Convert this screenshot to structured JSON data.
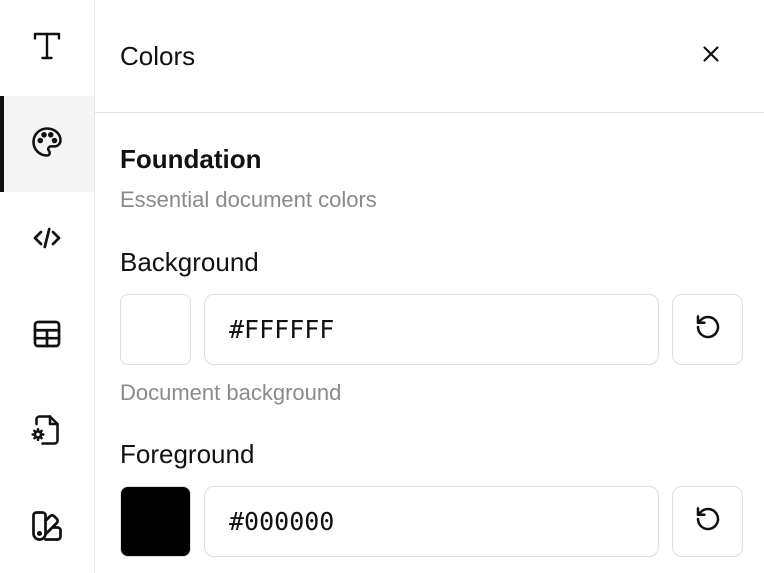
{
  "sidebar": {
    "items": [
      {
        "icon": "text-icon",
        "active": false
      },
      {
        "icon": "palette-icon",
        "active": true
      },
      {
        "icon": "code-icon",
        "active": false
      },
      {
        "icon": "table-icon",
        "active": false
      },
      {
        "icon": "file-settings-icon",
        "active": false
      },
      {
        "icon": "swatch-book-icon",
        "active": false
      }
    ]
  },
  "panel": {
    "title": "Colors",
    "section": {
      "title": "Foundation",
      "description": "Essential document colors"
    },
    "fields": [
      {
        "label": "Background",
        "value": "#FFFFFF",
        "hint": "Document background",
        "swatch_color": "#FFFFFF"
      },
      {
        "label": "Foreground",
        "value": "#000000",
        "swatch_color": "#000000"
      }
    ]
  }
}
